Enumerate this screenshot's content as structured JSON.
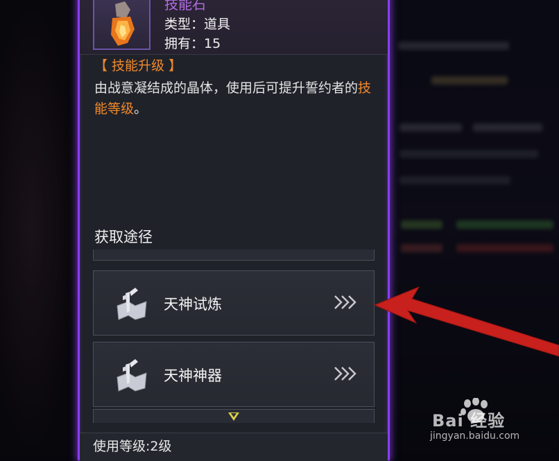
{
  "item": {
    "name": "技能石",
    "type_line": "类型：道具",
    "own_line": "拥有：15",
    "section_tag": "【 技能升级 】",
    "description_pre": "由战意凝结成的晶体，使用后可提升誓约者的",
    "description_highlight": "技能等级",
    "description_post": "。",
    "icon": "orange-crystal-icon"
  },
  "acquire": {
    "title": "获取途径",
    "routes": [
      {
        "label": "天神试炼",
        "icon": "map-statue-icon",
        "go_icon": "triple-chevron-right-icon"
      },
      {
        "label": "天神神器",
        "icon": "map-statue-icon",
        "go_icon": "triple-chevron-right-icon"
      }
    ],
    "more_icon": "chevron-down-icon"
  },
  "footer": {
    "use_level": "使用等级:2级"
  },
  "watermark": {
    "brand": "Bai  经验",
    "url": "jingyan.baidu.com"
  },
  "colors": {
    "accent_orange": "#f08a2a",
    "border_purple": "#8a3cff",
    "name_purple": "#b06de0",
    "pointer_red": "#c8201c"
  }
}
